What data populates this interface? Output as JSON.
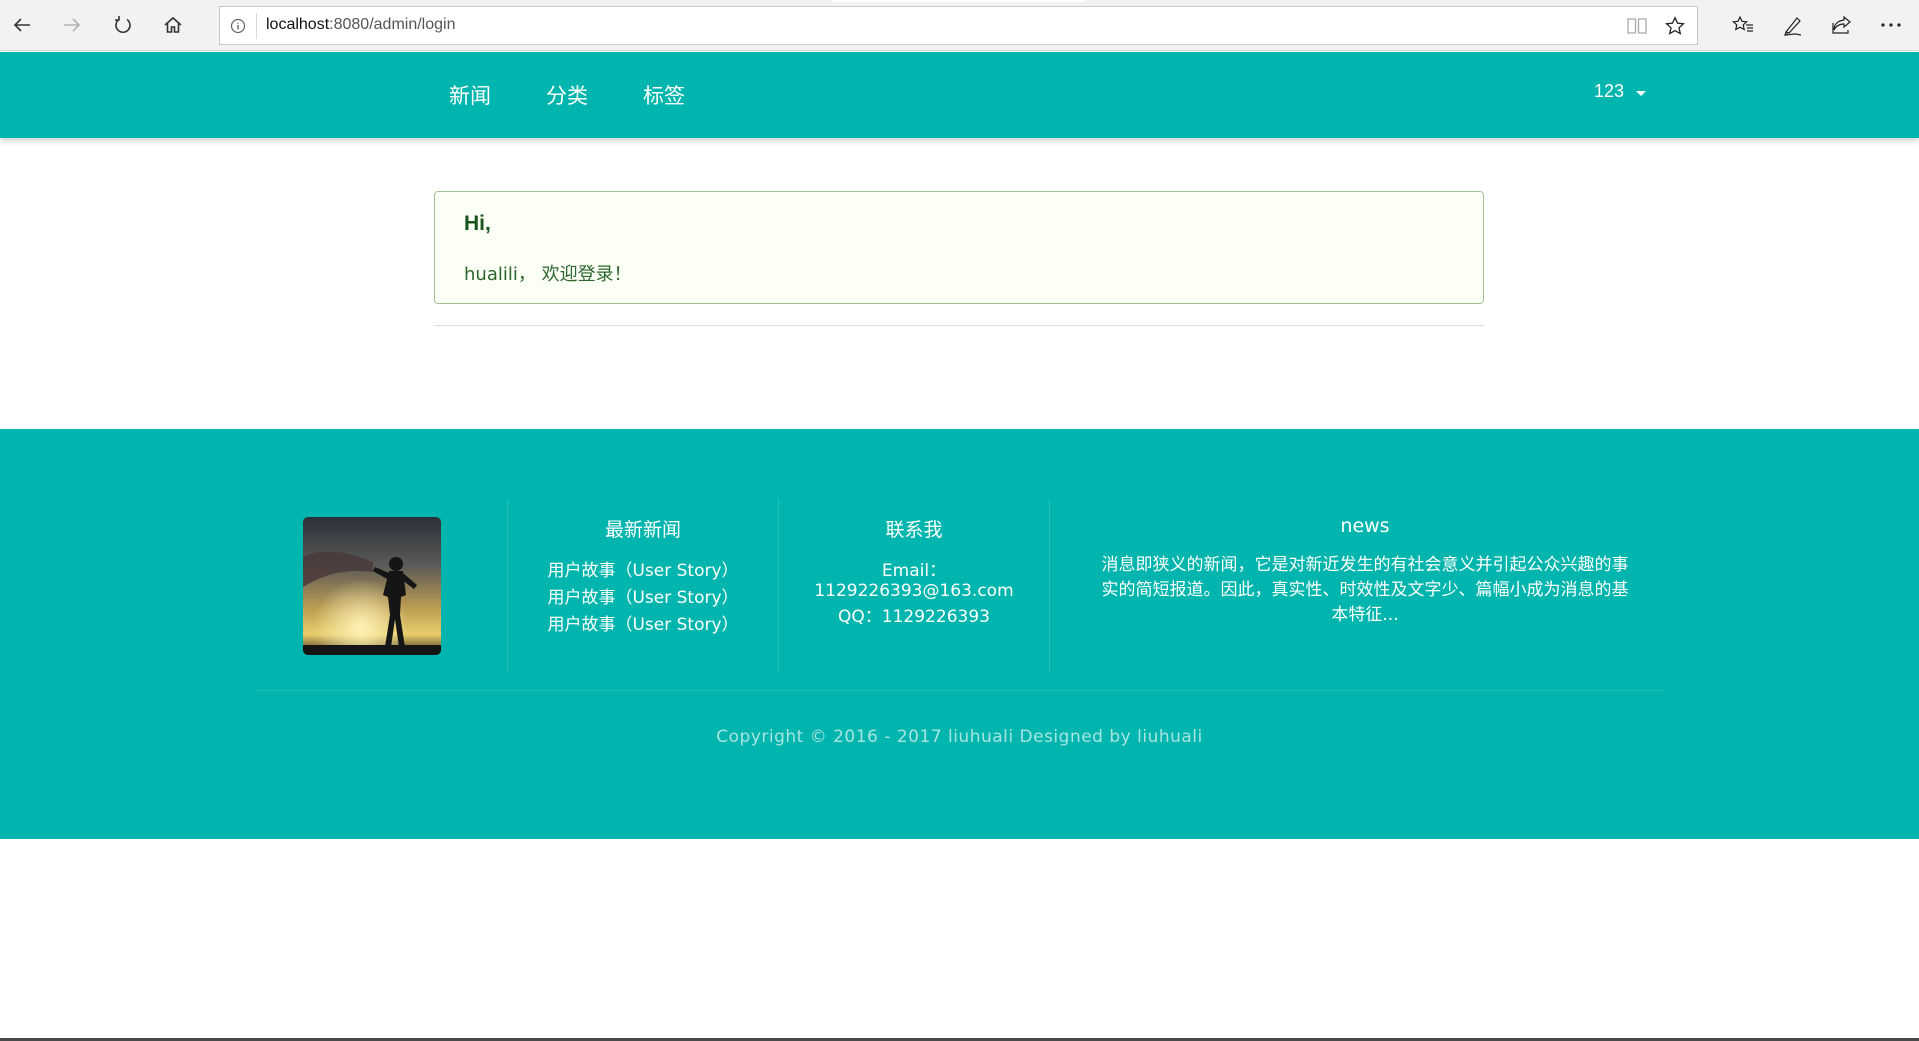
{
  "browser": {
    "url_host": "localhost",
    "url_rest": ":8080/admin/login"
  },
  "navbar": {
    "items": [
      {
        "label": "新闻"
      },
      {
        "label": "分类"
      },
      {
        "label": "标签"
      }
    ],
    "user": "123"
  },
  "message": {
    "header": "Hi,",
    "text": "hualili，  欢迎登录！"
  },
  "footer": {
    "latest": {
      "title": "最新新闻",
      "items": [
        "用户故事（User Story）",
        "用户故事（User Story）",
        "用户故事（User Story）"
      ]
    },
    "contact": {
      "title": "联系我",
      "email_label": "Email：",
      "email": "1129226393@163.com",
      "qq": "QQ：1129226393"
    },
    "news": {
      "title": "news",
      "lines": [
        "消息即狭义的新闻，它是对新近发生的有社会意义并引起公众兴趣的事",
        "实的简短报道。因此，真实性、时效性及文字少、篇幅小成为消息的基",
        "本特征..."
      ]
    },
    "copyright": "Copyright © 2016 - 2017 liuhuali Designed by liuhuali"
  },
  "colors": {
    "primary": "#00b5ad",
    "message_bg": "#fcfff5",
    "message_border": "#a3c293"
  }
}
